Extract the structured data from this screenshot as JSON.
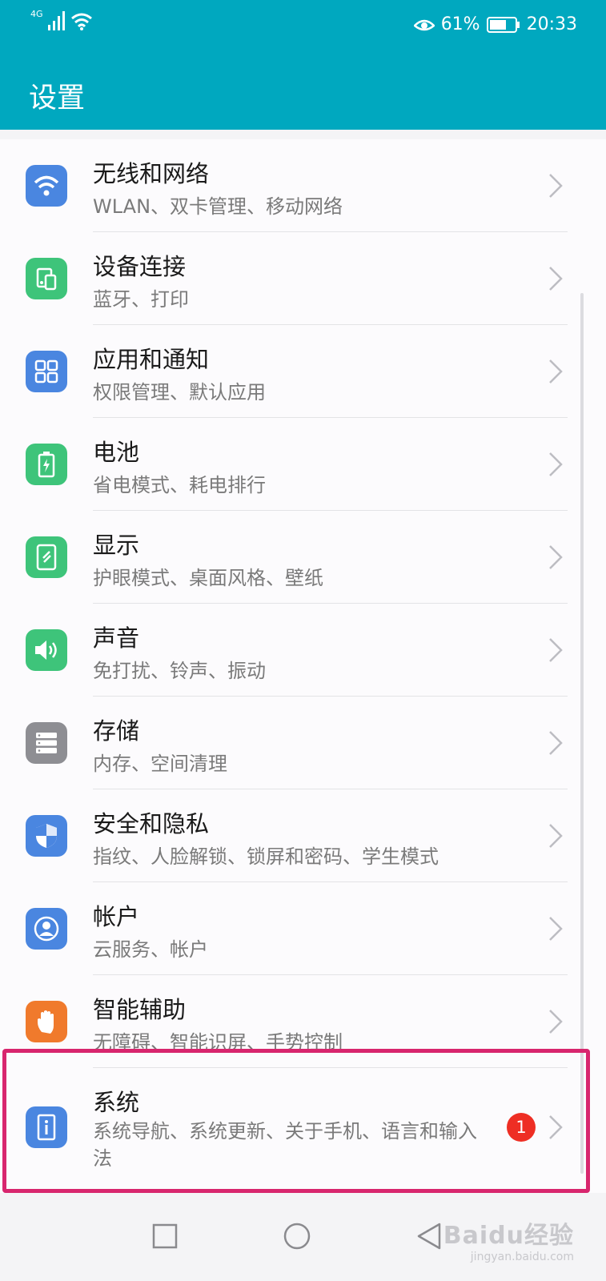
{
  "status_bar": {
    "network": "4G",
    "battery": "61%",
    "time": "20:33"
  },
  "app_bar": {
    "title": "设置"
  },
  "items": [
    {
      "title": "无线和网络",
      "subtitle": "WLAN、双卡管理、移动网络",
      "icon": "wifi-icon",
      "color": "#4a86e0"
    },
    {
      "title": "设备连接",
      "subtitle": "蓝牙、打印",
      "icon": "device-connection-icon",
      "color": "#3ec47a"
    },
    {
      "title": "应用和通知",
      "subtitle": "权限管理、默认应用",
      "icon": "apps-grid-icon",
      "color": "#4a86e0"
    },
    {
      "title": "电池",
      "subtitle": "省电模式、耗电排行",
      "icon": "battery-icon",
      "color": "#3ec47a"
    },
    {
      "title": "显示",
      "subtitle": "护眼模式、桌面风格、壁纸",
      "icon": "display-icon",
      "color": "#3ec47a"
    },
    {
      "title": "声音",
      "subtitle": "免打扰、铃声、振动",
      "icon": "speaker-icon",
      "color": "#3ec47a"
    },
    {
      "title": "存储",
      "subtitle": "内存、空间清理",
      "icon": "storage-icon",
      "color": "#8e8e93"
    },
    {
      "title": "安全和隐私",
      "subtitle": "指纹、人脸解锁、锁屏和密码、学生模式",
      "icon": "shield-icon",
      "color": "#4a86e0"
    },
    {
      "title": "帐户",
      "subtitle": "云服务、帐户",
      "icon": "account-icon",
      "color": "#4a86e0"
    },
    {
      "title": "智能辅助",
      "subtitle": "无障碍、智能识屏、手势控制",
      "icon": "hand-icon",
      "color": "#f07a2c"
    },
    {
      "title": "系统",
      "subtitle": "系统导航、系统更新、关于手机、语言和输入法",
      "icon": "system-info-icon",
      "color": "#4a86e0",
      "badge": "1"
    }
  ],
  "highlight_color": "#d8266e",
  "watermark": {
    "brand": "Baidu经验",
    "url": "jingyan.baidu.com"
  }
}
